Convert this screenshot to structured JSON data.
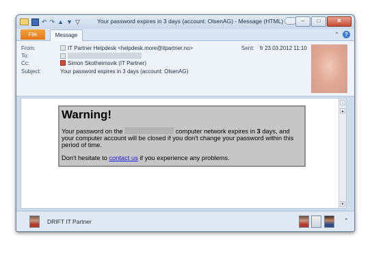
{
  "window": {
    "title": "Your password expires in 3 days (account: OlsenAG)  -  Message (HTML)",
    "controls": {
      "minimize": "–",
      "maximize": "□",
      "close": "✕"
    },
    "quick_access": {
      "undo": "↶",
      "redo": "↷",
      "up": "▲",
      "down": "▼",
      "customize": "▽"
    }
  },
  "ribbon": {
    "tabs": [
      {
        "label": "File"
      },
      {
        "label": "Message"
      }
    ],
    "collapse_icon": "⌃",
    "help_icon": "?"
  },
  "header": {
    "from_label": "From:",
    "from_value": "IT Partner Helpdesk <helpdesk.more@itpartner.no>",
    "to_label": "To:",
    "cc_label": "Cc:",
    "cc_value": "Simon Skotheimsvik (IT Partner)",
    "subject_label": "Subject:",
    "subject_value": "Your password expires in 3 days (account: OlsenAG)",
    "sent_label": "Sent:",
    "sent_value": "fr 23.03.2012 11:10"
  },
  "message": {
    "heading": "Warning!",
    "p1_before": "Your password on the ",
    "p1_after": " computer network expires in ",
    "p1_bold": "3",
    "p1_end": " days, and your computer account will be closed if you don't change your password within this period of time.",
    "p2_before": "Don't hesitate to ",
    "p2_link": "contact us",
    "p2_after": " if you experience any problems."
  },
  "scrollbar": {
    "up": "▲",
    "down": "▼",
    "zoom": "↕"
  },
  "people_pane": {
    "label": "DRIFT IT Partner",
    "expand_icon": "⌃"
  }
}
